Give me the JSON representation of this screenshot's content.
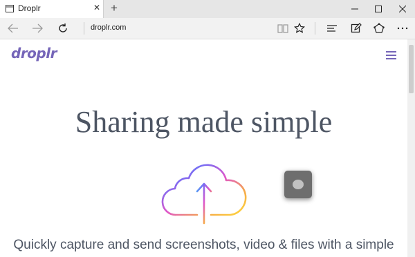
{
  "browser": {
    "tab": {
      "title": "Droplr"
    },
    "address_bar": {
      "url": "droplr.com"
    },
    "icons": {
      "tab_page": "page-icon",
      "tab_close": "close-icon",
      "new_tab": "plus-icon",
      "back": "back-arrow-icon",
      "forward": "forward-arrow-icon",
      "refresh": "refresh-icon",
      "reading_view": "book-icon",
      "favorites": "star-icon",
      "hub": "hub-icon",
      "web_note": "pen-icon",
      "share": "share-icon",
      "more": "more-icon",
      "minimize": "minimize-icon",
      "maximize": "maximize-icon",
      "close": "close-window-icon"
    },
    "glyphs": {
      "close": "✕",
      "new_tab": "+"
    }
  },
  "page": {
    "logo": "droplr",
    "menu_icon": "hamburger-icon",
    "headline": "Sharing made simple",
    "hero_icons": [
      "cloud-upload-icon",
      "app-icon"
    ],
    "tagline": "Quickly capture and send screenshots, video & files with a simple"
  },
  "colors": {
    "brand": "#7565b8",
    "headline": "#4d5563",
    "chrome_bg": "#f2f2f2",
    "tabstrip_bg": "#e6e6e6"
  }
}
